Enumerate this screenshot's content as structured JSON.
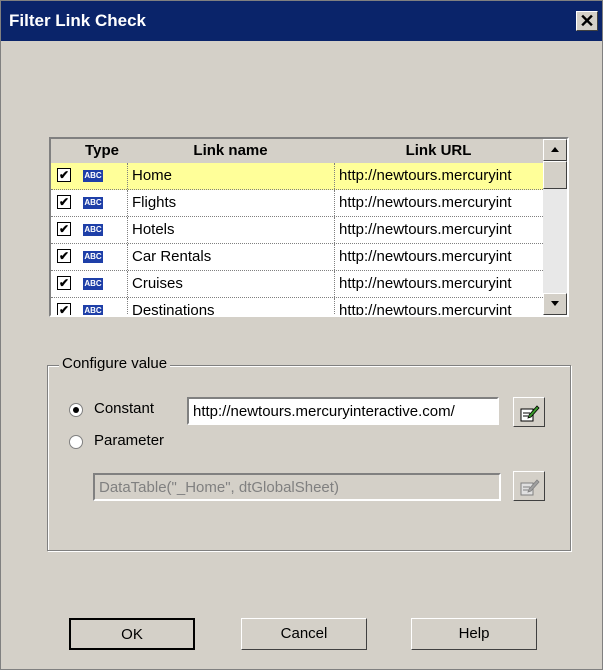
{
  "dialog": {
    "title": "Filter Link Check",
    "close_glyph": "✕"
  },
  "table": {
    "columns": [
      "",
      "Type",
      "Link name",
      "Link URL"
    ],
    "type_icon_text": "ABC",
    "rows": [
      {
        "checked": true,
        "name": "Home",
        "url": "http://newtours.mercuryint",
        "selected": true
      },
      {
        "checked": true,
        "name": "Flights",
        "url": "http://newtours.mercuryint",
        "selected": false
      },
      {
        "checked": true,
        "name": "Hotels",
        "url": "http://newtours.mercuryint",
        "selected": false
      },
      {
        "checked": true,
        "name": "Car Rentals",
        "url": "http://newtours.mercuryint",
        "selected": false
      },
      {
        "checked": true,
        "name": "Cruises",
        "url": "http://newtours.mercuryint",
        "selected": false
      },
      {
        "checked": true,
        "name": "Destinations",
        "url": "http://newtours.mercuryint",
        "selected": false
      }
    ]
  },
  "configure": {
    "label": "Configure value",
    "constant_label": "Constant",
    "constant_selected": true,
    "constant_value": "http://newtours.mercuryinteractive.com/",
    "parameter_label": "Parameter",
    "parameter_value": "DataTable(\"_Home\", dtGlobalSheet)"
  },
  "buttons": {
    "ok": "OK",
    "cancel": "Cancel",
    "help": "Help"
  },
  "colors": {
    "titlebar": "#0a246a",
    "selected_row": "#ffff99",
    "face": "#d4d0c8"
  }
}
